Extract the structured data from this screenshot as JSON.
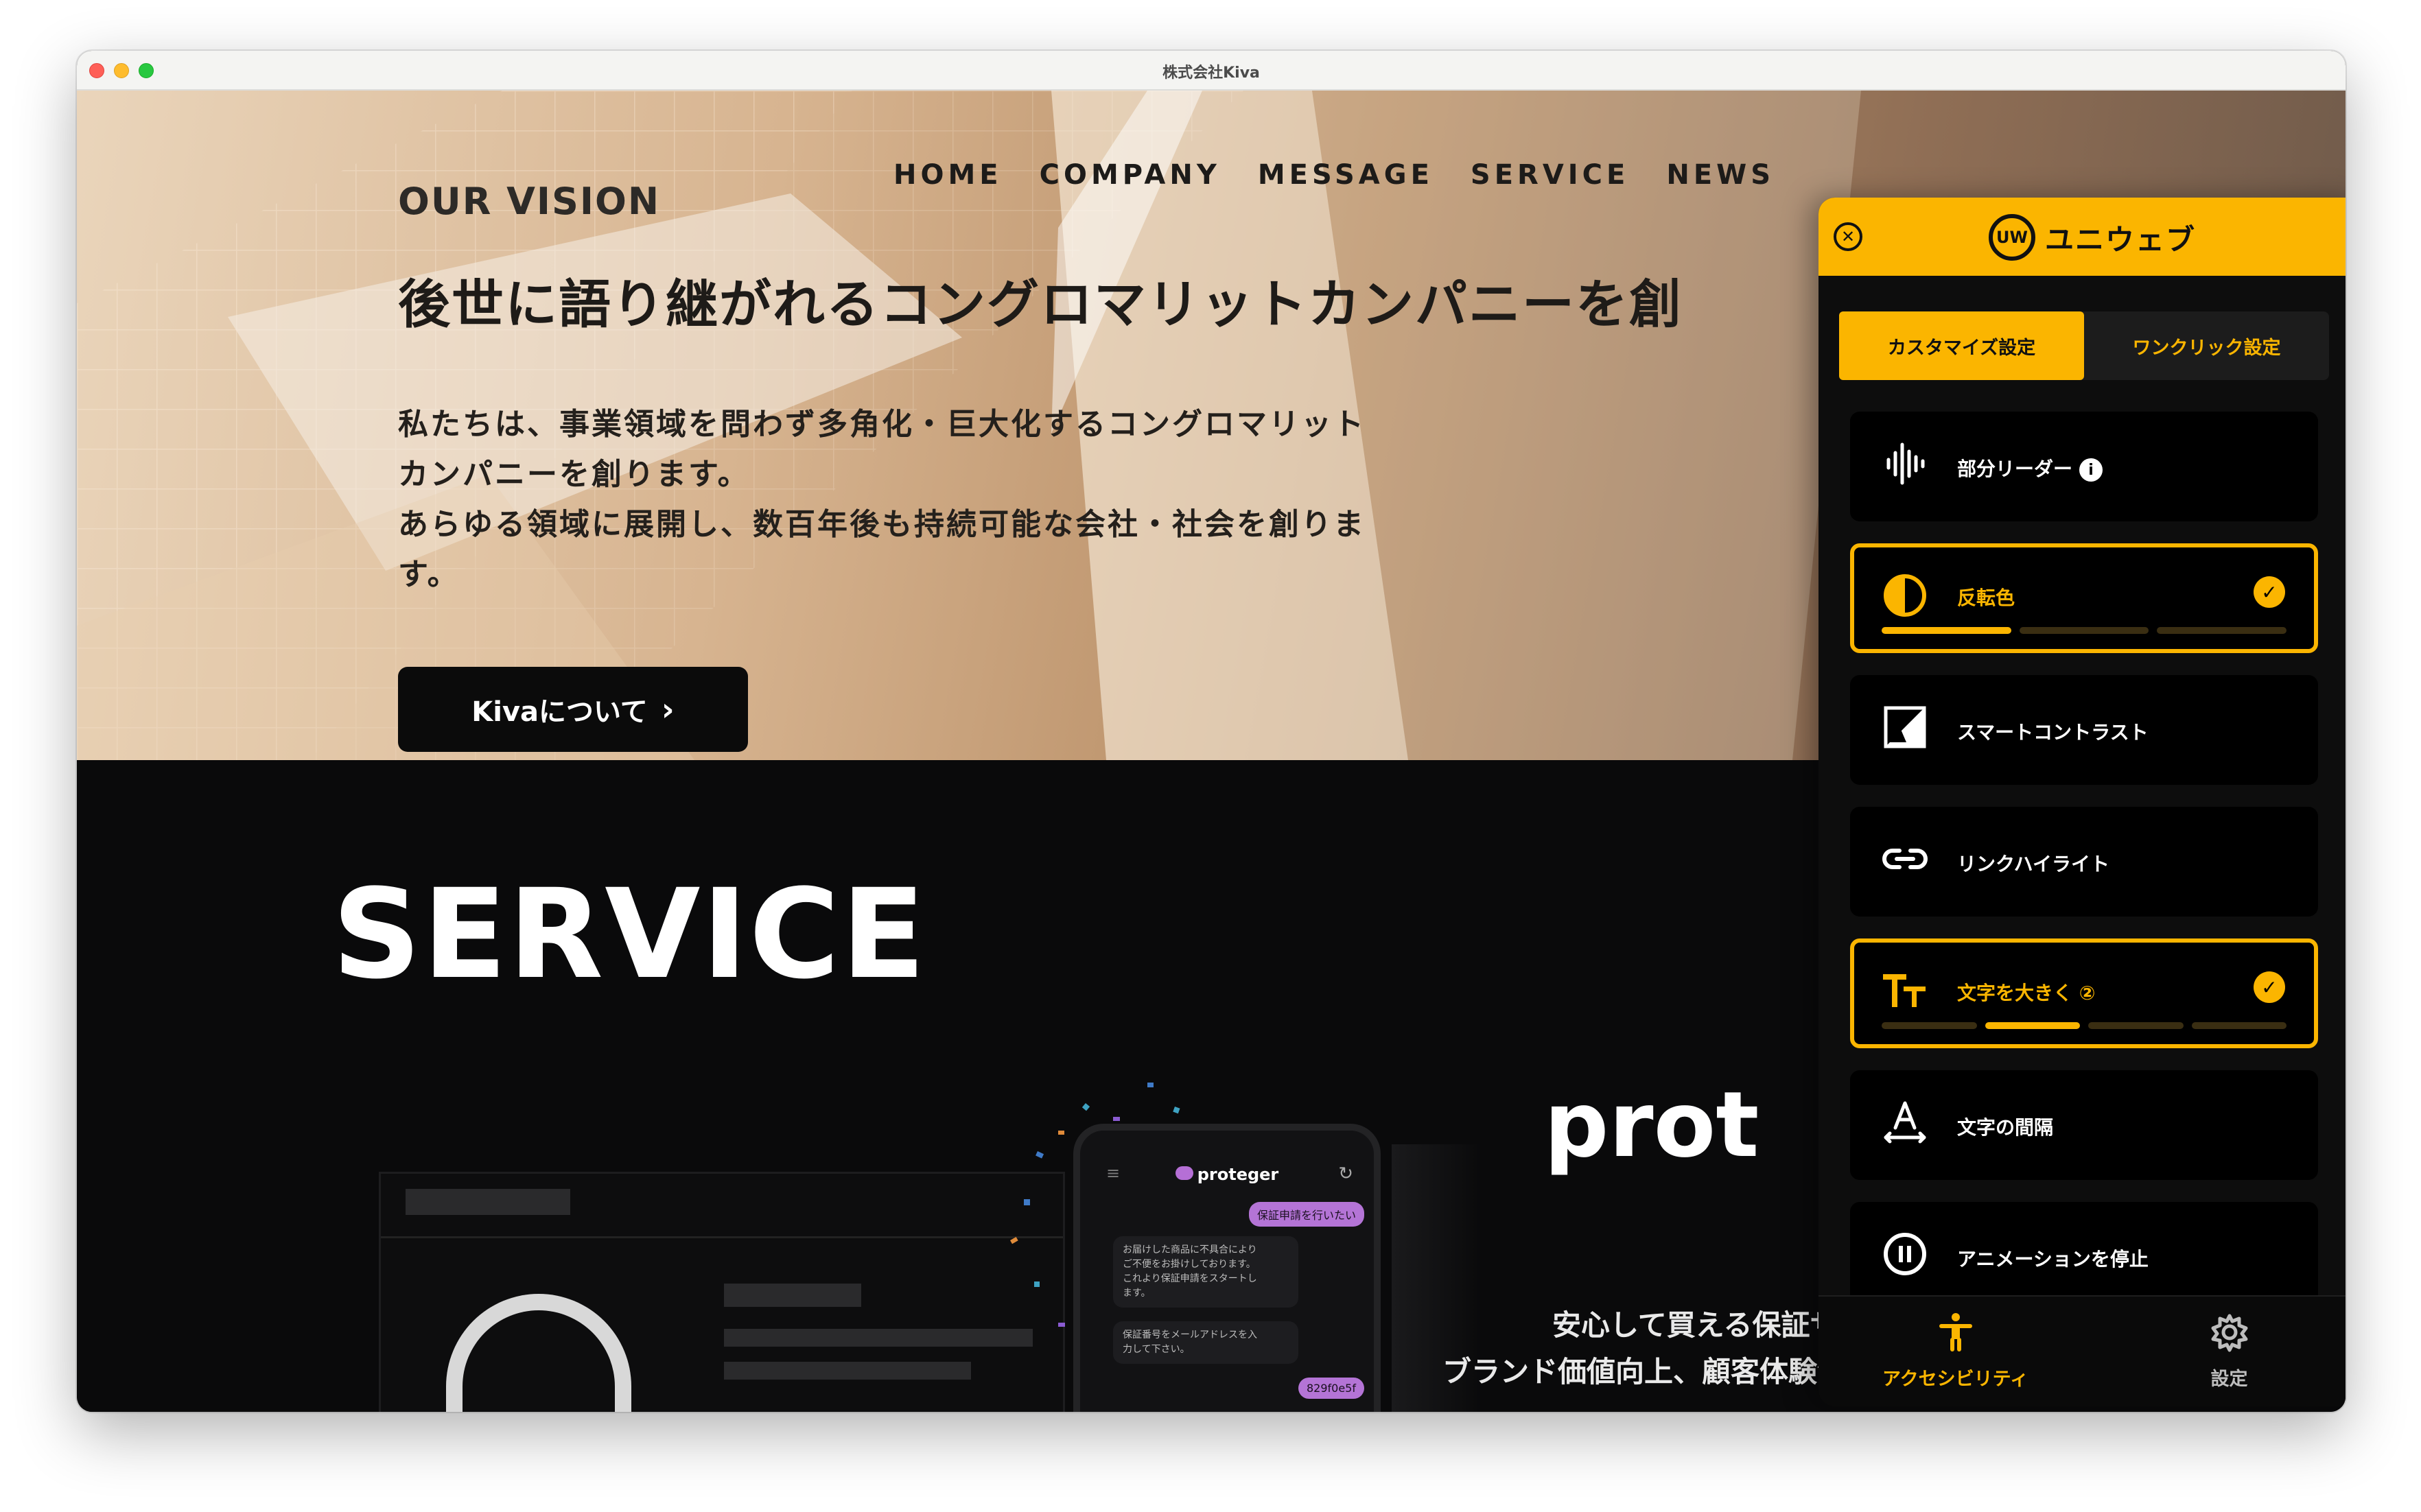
{
  "window": {
    "title": "株式会社Kiva"
  },
  "nav": {
    "items": [
      "HOME",
      "COMPANY",
      "MESSAGE",
      "SERVICE",
      "NEWS"
    ]
  },
  "hero": {
    "eyebrow": "OUR VISION",
    "headline": "後世に語り継がれるコングロマリットカンパニーを創",
    "body_lines": [
      "私たちは、事業領域を問わず多角化・巨大化するコングロマリット",
      "カンパニーを創ります。",
      "あらゆる領域に展開し、数百年後も持続可能な会社・社会を創りま",
      "す。"
    ],
    "button_label": "Kivaについて",
    "button_icon": "chevron-right-icon"
  },
  "service": {
    "title": "SERVICE",
    "product_title_partial": "prot",
    "desc_line1": "安心して買える保証サービス",
    "desc_line2": "ブランド価値向上、顧客体験満足度を実現し",
    "phone": {
      "brand": "proteger",
      "bubble1": "保証申請を行いたい",
      "bubble2": "お届けした商品に不具合により\nご不便をお掛けしております。\nこれより保証申請をスタートし\nます。",
      "bubble3": "保証番号をメールアドレスを入\n力して下さい。",
      "bubble4": "829f0e5f"
    }
  },
  "widget": {
    "brand_logo_text": "UW",
    "brand_name": "ユニウェブ",
    "close_icon": "close-circle-icon",
    "tabs": [
      {
        "label": "カスタマイズ設定",
        "active": true
      },
      {
        "label": "ワンクリック設定",
        "active": false
      }
    ],
    "features": [
      {
        "label": "部分リーダー",
        "icon": "soundwave-icon",
        "active": false,
        "info": "i"
      },
      {
        "label": "反転色",
        "icon": "contrast-half-icon",
        "active": true,
        "levels_total": 3,
        "level": 1
      },
      {
        "label": "スマートコントラスト",
        "icon": "smart-contrast-icon",
        "active": false
      },
      {
        "label": "リンクハイライト",
        "icon": "link-icon",
        "active": false
      },
      {
        "label": "文字を大きく ②",
        "icon": "text-size-icon",
        "active": true,
        "levels_total": 4,
        "level": 2
      },
      {
        "label": "文字の間隔",
        "icon": "letter-spacing-icon",
        "active": false
      },
      {
        "label": "アニメーションを停止",
        "icon": "pause-circle-icon",
        "active": false
      }
    ],
    "check_icon": "check-circle-icon",
    "footer": [
      {
        "label": "アクセシビリティ",
        "icon": "accessibility-person-icon",
        "active": true
      },
      {
        "label": "設定",
        "icon": "gear-icon",
        "active": false
      }
    ],
    "colors": {
      "accent": "#fbb500",
      "panel": "#0d0d0d",
      "card": "#000000"
    }
  }
}
